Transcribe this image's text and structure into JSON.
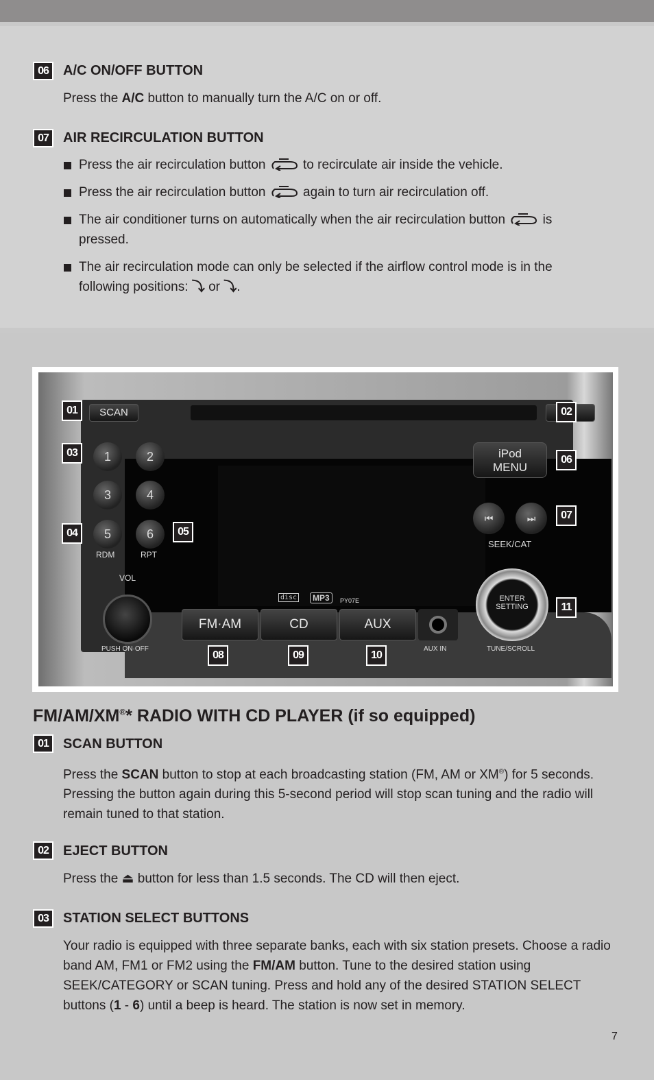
{
  "sections_top": {
    "s06": {
      "num": "06",
      "title": "A/C ON/OFF BUTTON",
      "text_pre": "Press the ",
      "text_bold": "A/C",
      "text_post": " button to manually turn the A/C on or off."
    },
    "s07": {
      "num": "07",
      "title": "AIR RECIRCULATION BUTTON",
      "b1_pre": "Press the air recirculation button",
      "b1_post": "to recirculate air inside the vehicle.",
      "b2_pre": "Press the air recirculation button",
      "b2_post": "again to turn air recirculation off.",
      "b3_pre": "The air conditioner turns on automatically when the air recirculation button",
      "b3_post": "is pressed.",
      "b4_pre": "The air recirculation mode can only be selected if the airflow control mode is in the following positions:",
      "b4_or": "or",
      "b4_end": "."
    }
  },
  "radio": {
    "callouts": [
      "01",
      "02",
      "03",
      "04",
      "05",
      "06",
      "07",
      "08",
      "09",
      "10",
      "11"
    ],
    "scan": "SCAN",
    "presets": [
      "1",
      "2",
      "3",
      "4",
      "5",
      "6"
    ],
    "rdm": "RDM",
    "rpt": "RPT",
    "vol": "VOL",
    "push": "PUSH  ON·OFF",
    "ipod1": "iPod",
    "ipod2": "MENU",
    "seek": "SEEK/CAT",
    "fmam": "FM·AM",
    "cd": "CD",
    "aux": "AUX",
    "auxin": "AUX IN",
    "enter": "ENTER",
    "setting": "SETTING",
    "tune": "TUNE/SCROLL",
    "mp3": "MP3",
    "model": "PY07E",
    "disc": "disc"
  },
  "main": {
    "heading_pre": "FM/AM/XM",
    "heading_sup": "®",
    "heading_post": "* RADIO WITH CD PLAYER (if so equipped)",
    "s01": {
      "num": "01",
      "title": "SCAN BUTTON",
      "t1": "Press the ",
      "b": "SCAN",
      "t2": " button to stop at each broadcasting station (FM, AM or XM",
      "sup": "®",
      "t3": ") for 5 seconds. Pressing the button again during this 5-second period will stop scan tuning and the radio will remain tuned to that station."
    },
    "s02": {
      "num": "02",
      "title": "EJECT BUTTON",
      "t1": "Press the ",
      "t2": " button for less than 1.5 seconds. The CD will then eject."
    },
    "s03": {
      "num": "03",
      "title": "STATION SELECT BUTTONS",
      "t1": "Your radio is equipped with three separate banks, each with six station presets. Choose a radio band AM, FM1 or FM2 using the ",
      "b": "FM/AM",
      "t2": " button. Tune to the desired station using SEEK/CATEGORY or SCAN tuning.  Press and hold any of the desired STATION SELECT buttons (",
      "b2": "1",
      "t3": " - ",
      "b3": "6",
      "t4": ") until a beep is heard. The station is now set in memory."
    }
  },
  "page_number": "7"
}
